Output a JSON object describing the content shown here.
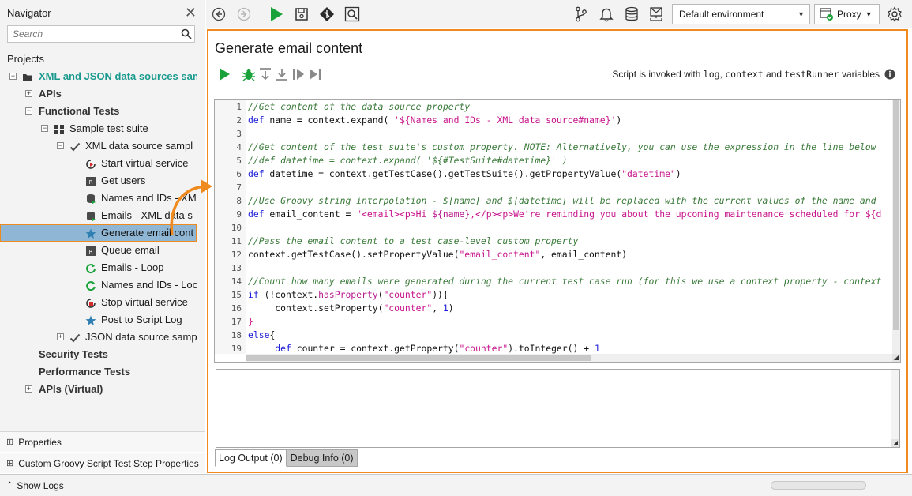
{
  "navigator": {
    "title": "Navigator",
    "search_placeholder": "Search",
    "projects_label": "Projects",
    "tree": [
      {
        "label": "XML and JSON data sources sam",
        "level": 0,
        "icon": "folder-icon",
        "expander": "−",
        "style": "teal"
      },
      {
        "label": "APIs",
        "level": 1,
        "icon": "",
        "expander": "+",
        "style": "bold"
      },
      {
        "label": "Functional Tests",
        "level": 1,
        "icon": "",
        "expander": "−",
        "style": "bold"
      },
      {
        "label": "Sample test suite",
        "level": 2,
        "icon": "test-suite-icon",
        "expander": "−",
        "style": ""
      },
      {
        "label": "XML data source sampl",
        "level": 3,
        "icon": "checkmark-icon",
        "expander": "−",
        "style": ""
      },
      {
        "label": "Start virtual service",
        "level": 4,
        "icon": "start-virt-icon",
        "expander": "",
        "style": ""
      },
      {
        "label": "Get users",
        "level": 4,
        "icon": "rest-request-icon",
        "expander": "",
        "style": ""
      },
      {
        "label": "Names and IDs - XM",
        "level": 4,
        "icon": "datasource-icon",
        "expander": "",
        "style": ""
      },
      {
        "label": "Emails - XML data s",
        "level": 4,
        "icon": "datasource-icon",
        "expander": "",
        "style": ""
      },
      {
        "label": "Generate email cont",
        "level": 4,
        "icon": "groovy-star-icon",
        "expander": "",
        "style": "",
        "selected": true
      },
      {
        "label": "Queue email",
        "level": 4,
        "icon": "rest-request-icon",
        "expander": "",
        "style": ""
      },
      {
        "label": "Emails - Loop",
        "level": 4,
        "icon": "loop-icon",
        "expander": "",
        "style": ""
      },
      {
        "label": "Names and IDs - Loo",
        "level": 4,
        "icon": "loop-icon",
        "expander": "",
        "style": ""
      },
      {
        "label": "Stop virtual service",
        "level": 4,
        "icon": "stop-virt-icon",
        "expander": "",
        "style": ""
      },
      {
        "label": "Post to Script Log",
        "level": 4,
        "icon": "groovy-star-icon",
        "expander": "",
        "style": ""
      },
      {
        "label": "JSON data source samp",
        "level": 3,
        "icon": "checkmark-icon",
        "expander": "+",
        "style": ""
      },
      {
        "label": "Security Tests",
        "level": 1,
        "icon": "",
        "expander": "",
        "style": "bold"
      },
      {
        "label": "Performance Tests",
        "level": 1,
        "icon": "",
        "expander": "",
        "style": "bold"
      },
      {
        "label": "APIs (Virtual)",
        "level": 1,
        "icon": "",
        "expander": "+",
        "style": "bold"
      }
    ]
  },
  "panels": {
    "properties": "Properties",
    "custom_props": "Custom Groovy Script Test Step Properties",
    "show_logs": "Show Logs"
  },
  "toolbar": {
    "environment": "Default environment",
    "proxy": "Proxy"
  },
  "editor": {
    "title": "Generate email content",
    "invoke_prefix": "Script is invoked with ",
    "invoke_var1": "log",
    "invoke_sep1": ", ",
    "invoke_var2": "context",
    "invoke_sep2": " and ",
    "invoke_var3": "testRunner",
    "invoke_suffix": " variables",
    "line_numbers": [
      "1",
      "2",
      "3",
      "4",
      "5",
      "6",
      "7",
      "8",
      "9",
      "10",
      "11",
      "12",
      "13",
      "14",
      "15",
      "16",
      "17",
      "18",
      "19"
    ],
    "code": [
      [
        {
          "t": "//Get content of the data source property",
          "c": "cm"
        }
      ],
      [
        {
          "t": "def",
          "c": "kw"
        },
        {
          "t": " name = context.expand( ",
          "c": ""
        },
        {
          "t": "'${Names and IDs - XML data source#name}'",
          "c": "st"
        },
        {
          "t": ")",
          "c": ""
        }
      ],
      [],
      [
        {
          "t": "//Get content of the test suite's custom property. NOTE: Alternatively, you can use the expression in the line below",
          "c": "cm"
        }
      ],
      [
        {
          "t": "//def datetime = context.expand( '${#TestSuite#datetime}' )",
          "c": "cm"
        }
      ],
      [
        {
          "t": "def",
          "c": "kw"
        },
        {
          "t": " datetime = context.getTestCase().getTestSuite().getPropertyValue(",
          "c": ""
        },
        {
          "t": "\"datetime\"",
          "c": "st"
        },
        {
          "t": ")",
          "c": ""
        }
      ],
      [],
      [
        {
          "t": "//Use Groovy string interpolation - ${name} and ${datetime} will be replaced with the current values of the name and",
          "c": "cm"
        }
      ],
      [
        {
          "t": "def",
          "c": "kw"
        },
        {
          "t": " email_content = ",
          "c": ""
        },
        {
          "t": "\"<email><p>Hi ",
          "c": "st"
        },
        {
          "t": "${name}",
          "c": "fn"
        },
        {
          "t": ",</p><p>We're reminding you about the upcoming maintenance scheduled for ${d",
          "c": "st"
        }
      ],
      [],
      [
        {
          "t": "//Pass the email content to a test case-level custom property",
          "c": "cm"
        }
      ],
      [
        {
          "t": "context.getTestCase().setPropertyValue(",
          "c": ""
        },
        {
          "t": "\"email_content\"",
          "c": "st"
        },
        {
          "t": ", email_content)",
          "c": ""
        }
      ],
      [],
      [
        {
          "t": "//Count how many emails were generated during the current test case run (for this we use a context property - context",
          "c": "cm"
        }
      ],
      [
        {
          "t": "if",
          "c": "kw"
        },
        {
          "t": " (!context.",
          "c": ""
        },
        {
          "t": "hasProperty",
          "c": "fn"
        },
        {
          "t": "(",
          "c": ""
        },
        {
          "t": "\"counter\"",
          "c": "st"
        },
        {
          "t": ")){",
          "c": ""
        }
      ],
      [
        {
          "t": "     context.setProperty(",
          "c": ""
        },
        {
          "t": "\"counter\"",
          "c": "st"
        },
        {
          "t": ", ",
          "c": ""
        },
        {
          "t": "1",
          "c": "nm"
        },
        {
          "t": ")",
          "c": ""
        }
      ],
      [
        {
          "t": "}",
          "c": "st"
        }
      ],
      [
        {
          "t": "else",
          "c": "kw"
        },
        {
          "t": "{",
          "c": ""
        }
      ],
      [
        {
          "t": "     ",
          "c": ""
        },
        {
          "t": "def",
          "c": "kw"
        },
        {
          "t": " counter = context.getProperty(",
          "c": ""
        },
        {
          "t": "\"counter\"",
          "c": "st"
        },
        {
          "t": ").toInteger() + ",
          "c": ""
        },
        {
          "t": "1",
          "c": "nm"
        }
      ]
    ],
    "tabs": [
      {
        "label": "Log Output (0)",
        "active": true
      },
      {
        "label": "Debug Info (0)",
        "active": false
      }
    ]
  },
  "colors": {
    "highlight_orange": "#ef8a1f",
    "selection_blue": "#8fb6d4",
    "run_green": "#1aa23a",
    "project_teal": "#1a9a8e"
  }
}
